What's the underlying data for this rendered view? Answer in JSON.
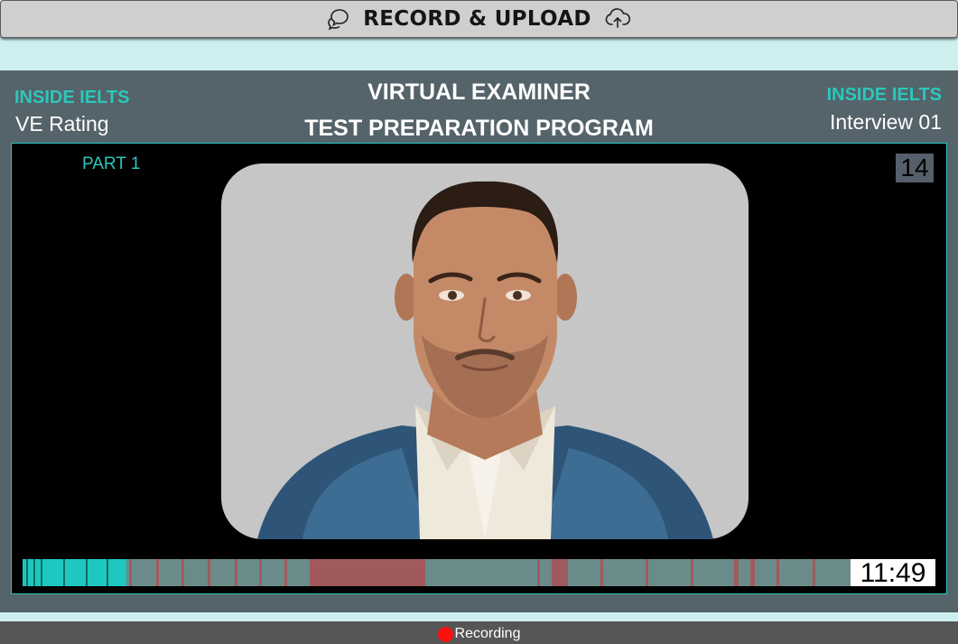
{
  "header": {
    "title": "RECORD & UPLOAD",
    "left_icon": "chat-bubbles-icon",
    "right_icon": "cloud-upload-icon"
  },
  "panel": {
    "brand_left": "INSIDE IELTS",
    "subtitle_left": "VE Rating",
    "title_line1": "VIRTUAL EXAMINER",
    "title_line2": "TEST PREPARATION PROGRAM",
    "brand_right": "INSIDE IELTS",
    "subtitle_right": "Interview 01"
  },
  "stage": {
    "part_label": "PART 1",
    "question_number": "14",
    "video": "examiner-avatar"
  },
  "timeline": {
    "time_display": "11:49"
  },
  "status": {
    "recording_label": "Recording"
  },
  "colors": {
    "accent": "#2cc7bb",
    "panel_bg": "#55636a",
    "page_bg": "#cdeff0",
    "timeline_track": "#6b8b8b",
    "timeline_played": "#1ec7bf",
    "timeline_marker": "#a05a5e",
    "recording_dot": "#ff1010"
  }
}
